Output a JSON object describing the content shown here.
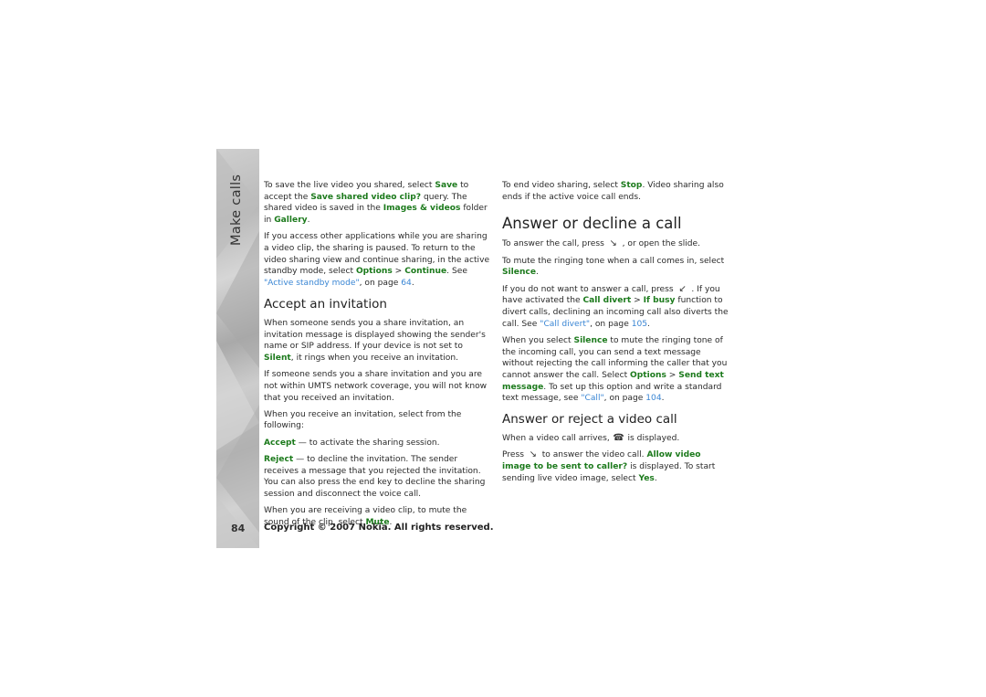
{
  "sidebar": {
    "section_title": "Make calls",
    "page_number": "84"
  },
  "footer": {
    "copyright": "Copyright © 2007 Nokia. All rights reserved."
  },
  "col1": {
    "p1": {
      "t1": "To save the live video you shared, select ",
      "save": "Save",
      "t2": " to accept the ",
      "query": "Save shared video clip?",
      "t3": " query. The shared video is saved in the ",
      "folder": "Images & videos",
      "t4": " folder in ",
      "gallery": "Gallery",
      "t5": "."
    },
    "p2": {
      "t1": "If you access other applications while you are sharing a video clip, the sharing is paused. To return to the video sharing view and continue sharing, in the active standby mode, select ",
      "options": "Options",
      "sep": " > ",
      "continue": "Continue",
      "t2": ". See ",
      "link": "\"Active standby mode\"",
      "t3": ", on page ",
      "page": "64",
      "t4": "."
    },
    "heading": "Accept an invitation",
    "p3": {
      "t1": "When someone sends you a share invitation, an invitation message is displayed showing the sender's name or SIP address. If your device is not set to ",
      "silent": "Silent",
      "t2": ", it rings when you receive an invitation."
    },
    "p4": "If someone sends you a share invitation and you are not within UMTS network coverage,  you will not know that you received an invitation.",
    "p5": "When you receive an invitation, select from the following:",
    "p6": {
      "accept": "Accept",
      "t1": " — to activate the sharing session."
    },
    "p7": {
      "reject": "Reject",
      "t1": " — to decline the invitation. The sender receives a message that you rejected the invitation. You can also press the end key to decline the sharing session and disconnect the voice call."
    },
    "p8": {
      "t1": "When you are receiving a video clip, to mute the sound of the clip, select ",
      "mute": "Mute",
      "t2": "."
    }
  },
  "col2": {
    "p1": {
      "t1": "To end video sharing, select ",
      "stop": "Stop",
      "t2": ". Video sharing also ends if the active voice call ends."
    },
    "heading1": "Answer or decline a call",
    "p2": {
      "t1": "To answer the call, press ",
      "icon": "call-key-icon",
      "t2": " , or open the slide."
    },
    "p3": {
      "t1": "To mute the ringing tone when a call comes in, select ",
      "silence": "Silence",
      "t2": "."
    },
    "p4": {
      "t1": "If you do not want to answer a call, press ",
      "icon": "end-key-icon",
      "t2": " . If you have activated the ",
      "divert": "Call divert",
      "sep": " > ",
      "busy": "If busy",
      "t3": " function to divert calls, declining an incoming call also diverts the call. See ",
      "link": "\"Call divert\"",
      "t4": ", on page ",
      "page": "105",
      "t5": "."
    },
    "p5": {
      "t1": "When you select ",
      "silence": "Silence",
      "t2": " to mute the ringing tone of the incoming call, you can send a text message without rejecting the call informing the caller that you cannot answer the call. Select ",
      "options": "Options",
      "sep": " > ",
      "send": "Send text message",
      "t3": ". To set up this option and write a standard text message, see ",
      "link": "\"Call\"",
      "t4": ", on page ",
      "page": "104",
      "t5": "."
    },
    "heading2": "Answer or reject a video call",
    "p6": {
      "t1": "When a video call arrives, ",
      "icon": "video-call-icon",
      "t2": " is displayed."
    },
    "p7": {
      "t1": "Press ",
      "icon": "call-key-icon",
      "t2": " to answer the video call. ",
      "allow": "Allow video image to be sent to caller?",
      "t3": " is displayed. To start sending live video image, select ",
      "yes": "Yes",
      "t4": "."
    }
  }
}
